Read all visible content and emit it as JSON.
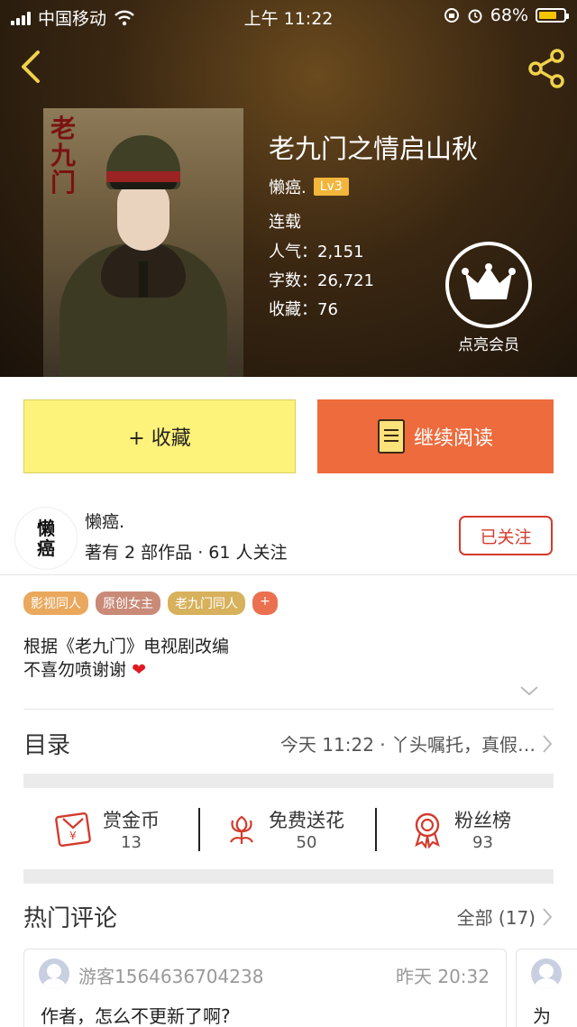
{
  "status_bar": {
    "carrier": "中国移动",
    "time": "上午 11:22",
    "battery": "68%"
  },
  "book": {
    "cover_text": "老九门",
    "title": "老九门之情启山秋",
    "author": "懒癌.",
    "level": "Lv3",
    "status": "连载",
    "popularity": "人气：2,151",
    "words": "字数：26,721",
    "favorites": "收藏：76"
  },
  "vip": {
    "label": "点亮会员"
  },
  "actions": {
    "collect": "+ 收藏",
    "read": "继续阅读"
  },
  "author_card": {
    "avatar_text": [
      "懒",
      "癌"
    ],
    "name": "懒癌.",
    "sub": "著有 2 部作品 · 61 人关注",
    "follow": "已关注"
  },
  "tags": [
    "影视同人",
    "原创女主",
    "老九门同人",
    "+"
  ],
  "description": {
    "line1": "根据《老九门》电视剧改编",
    "line2": "不喜勿喷谢谢",
    "heart": "❤"
  },
  "toc": {
    "label": "目录",
    "latest": "今天 11:22 · 丫头嘱托，真假…"
  },
  "stats": [
    {
      "label": "赏金币",
      "value": "13"
    },
    {
      "label": "免费送花",
      "value": "50"
    },
    {
      "label": "粉丝榜",
      "value": "93"
    }
  ],
  "hot_comments": {
    "label": "热门评论",
    "all": "全部 (17)",
    "items": [
      {
        "user": "游客1564636704238",
        "time": "昨天 20:32",
        "text": "作者，怎么不更新了啊?"
      },
      {
        "user": "",
        "time": "",
        "text": "为"
      }
    ]
  },
  "colors": {
    "collect_bg": "#fdf27a",
    "read_bg": "#ee6b3d",
    "follow": "#d33b2c",
    "level_badge": "#f3b53a"
  }
}
